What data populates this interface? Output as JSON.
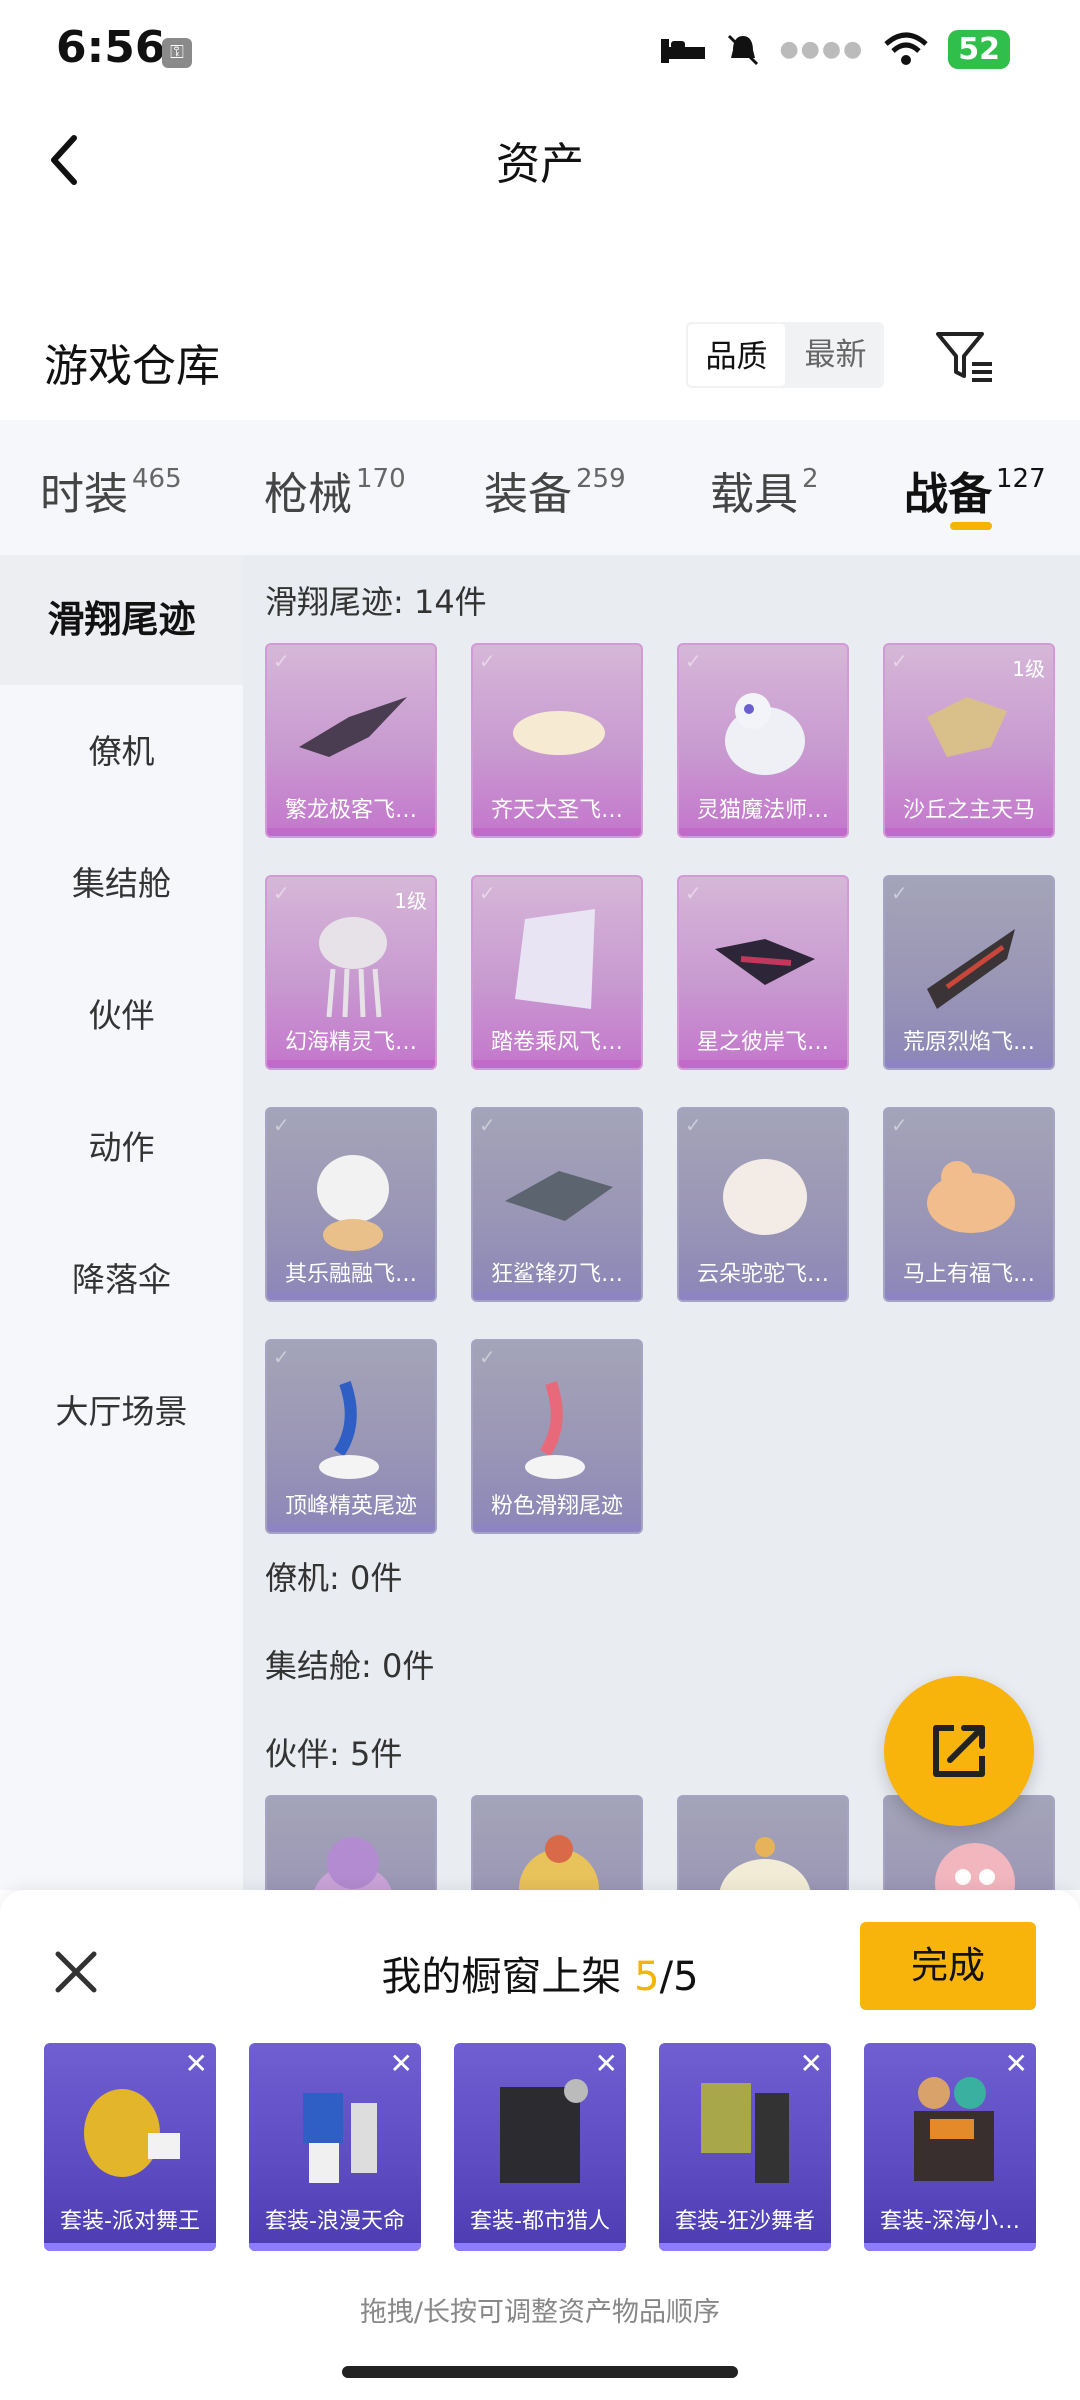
{
  "status_bar": {
    "time": "6:56",
    "battery": "52"
  },
  "header": {
    "title": "资产"
  },
  "warehouse": {
    "title": "游戏仓库",
    "sort_options": [
      "品质",
      "最新"
    ]
  },
  "category_tabs": [
    {
      "label": "时装",
      "count": "465"
    },
    {
      "label": "枪械",
      "count": "170"
    },
    {
      "label": "装备",
      "count": "259"
    },
    {
      "label": "载具",
      "count": "2"
    },
    {
      "label": "战备",
      "count": "127"
    }
  ],
  "sidebar": {
    "items": [
      "滑翔尾迹",
      "僚机",
      "集结舱",
      "伙伴",
      "动作",
      "降落伞",
      "大厅场景"
    ]
  },
  "sections": {
    "glide_trail": "滑翔尾迹: 14件",
    "wingman": "僚机: 0件",
    "rally_pod": "集结舱: 0件",
    "partner": "伙伴: 5件"
  },
  "items": [
    {
      "name": "繁龙极客飞…",
      "rarity": "pink",
      "level": ""
    },
    {
      "name": "齐天大圣飞…",
      "rarity": "pink",
      "level": ""
    },
    {
      "name": "灵猫魔法师…",
      "rarity": "pink",
      "level": ""
    },
    {
      "name": "沙丘之主天马",
      "rarity": "pink",
      "level": "1级"
    },
    {
      "name": "幻海精灵飞…",
      "rarity": "pink",
      "level": "1级"
    },
    {
      "name": "踏卷乘风飞…",
      "rarity": "pink",
      "level": ""
    },
    {
      "name": "星之彼岸飞…",
      "rarity": "pink",
      "level": ""
    },
    {
      "name": "荒原烈焰飞…",
      "rarity": "purple",
      "level": ""
    },
    {
      "name": "其乐融融飞…",
      "rarity": "purple",
      "level": ""
    },
    {
      "name": "狂鲨锋刃飞…",
      "rarity": "purple",
      "level": ""
    },
    {
      "name": "云朵驼驼飞…",
      "rarity": "purple",
      "level": ""
    },
    {
      "name": "马上有福飞…",
      "rarity": "purple",
      "level": ""
    },
    {
      "name": "顶峰精英尾迹",
      "rarity": "purple",
      "level": ""
    },
    {
      "name": "粉色滑翔尾迹",
      "rarity": "purple",
      "level": ""
    }
  ],
  "panel": {
    "title_prefix": "我的橱窗上架 ",
    "count": "5",
    "total": "/5",
    "done_label": "完成",
    "hint": "拖拽/长按可调整资产物品顺序",
    "shelf": [
      "套装-派对舞王",
      "套装-浪漫天命",
      "套装-都市猎人",
      "套装-狂沙舞者",
      "套装-深海小…"
    ]
  },
  "colors": {
    "accent": "#f8b40a",
    "pink_card": "#c476cc",
    "purple_card": "#8c86b8",
    "shelf_card": "#5d4bc2"
  }
}
